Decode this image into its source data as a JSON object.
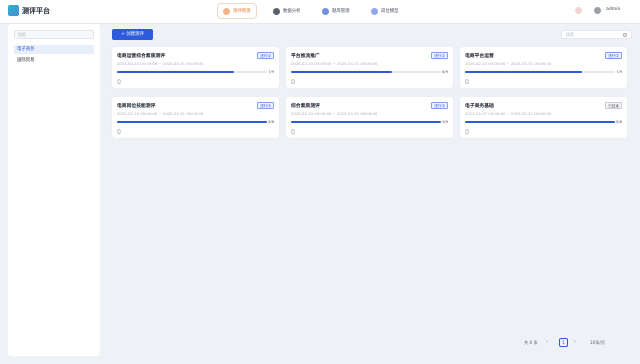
{
  "app": {
    "title": "测评平台"
  },
  "nav": [
    {
      "label": "测评管理",
      "active": true
    },
    {
      "label": "数据分析",
      "active": false
    },
    {
      "label": "题库管理",
      "active": false
    },
    {
      "label": "岗位模型",
      "active": false
    }
  ],
  "user": {
    "name": "admin"
  },
  "sidebar": {
    "search_placeholder": "搜索",
    "items": [
      {
        "label": "电子商务",
        "active": true
      },
      {
        "label": "国际贸易",
        "active": false
      }
    ]
  },
  "toolbar": {
    "create_label": "+ 创建测评",
    "search_placeholder": "搜索"
  },
  "cards": [
    {
      "title": "电商运营综合素质测评",
      "status": "进行中",
      "status_type": "running",
      "dates": "2025-02-10 00:00:00 ~ 2025-03-31 00:00:00",
      "progress_text": "7/9",
      "progress": 0.78
    },
    {
      "title": "平台推流推广",
      "status": "进行中",
      "status_type": "running",
      "dates": "2025-02-10 00:00:00 ~ 2025-03-31 00:00:00",
      "progress_text": "6/9",
      "progress": 0.67
    },
    {
      "title": "电商平台运营",
      "status": "进行中",
      "status_type": "running",
      "dates": "2025-02-10 00:00:00 ~ 2025-03-31 00:00:00",
      "progress_text": "7/9",
      "progress": 0.78
    },
    {
      "title": "电商岗位技能测评",
      "status": "进行中",
      "status_type": "running",
      "dates": "2025-02-10 00:00:00 ~ 2025-03-31 00:00:00",
      "progress_text": "8/8",
      "progress": 1.0
    },
    {
      "title": "综合素质测评",
      "status": "进行中",
      "status_type": "running",
      "dates": "2025-02-10 00:00:00 ~ 2025-03-31 00:00:00",
      "progress_text": "9/9",
      "progress": 1.0
    },
    {
      "title": "电子商务基础",
      "status": "已结束",
      "status_type": "ended",
      "dates": "2025-02-07 00:00:00 ~ 2025-02-21 00:00:00",
      "progress_text": "8/8",
      "progress": 1.0
    }
  ],
  "pagination": {
    "total_text": "共 6 条",
    "current_page": "1",
    "page_size_text": "10条/页"
  },
  "colors": {
    "accent": "#2d5bdc",
    "active_nav": "#e07b3a"
  }
}
